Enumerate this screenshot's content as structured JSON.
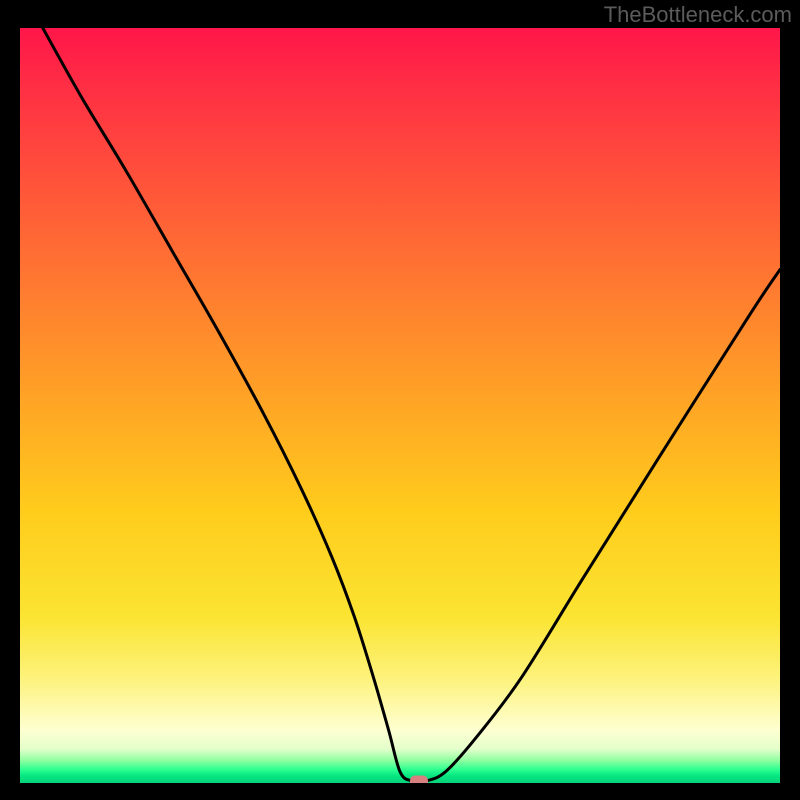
{
  "watermark": "TheBottleneck.com",
  "chart_data": {
    "type": "line",
    "title": "",
    "xlabel": "",
    "ylabel": "",
    "xlim": [
      0,
      100
    ],
    "ylim": [
      0,
      100
    ],
    "series": [
      {
        "name": "bottleneck-curve",
        "x": [
          3,
          8,
          14,
          20,
          26,
          32,
          37,
          41,
          44,
          46.5,
          48.5,
          50,
          51.5,
          53.5,
          56,
          60,
          66,
          74,
          84,
          96,
          100
        ],
        "values": [
          100,
          91,
          81,
          70.5,
          60,
          49,
          39,
          30,
          22,
          14,
          7,
          1.5,
          0.3,
          0.3,
          1.5,
          6,
          14,
          27,
          43,
          62,
          68
        ]
      }
    ],
    "min_marker": {
      "x": 52.5,
      "y": 0.3,
      "shape": "rounded-rect",
      "color": "#d88080"
    }
  }
}
